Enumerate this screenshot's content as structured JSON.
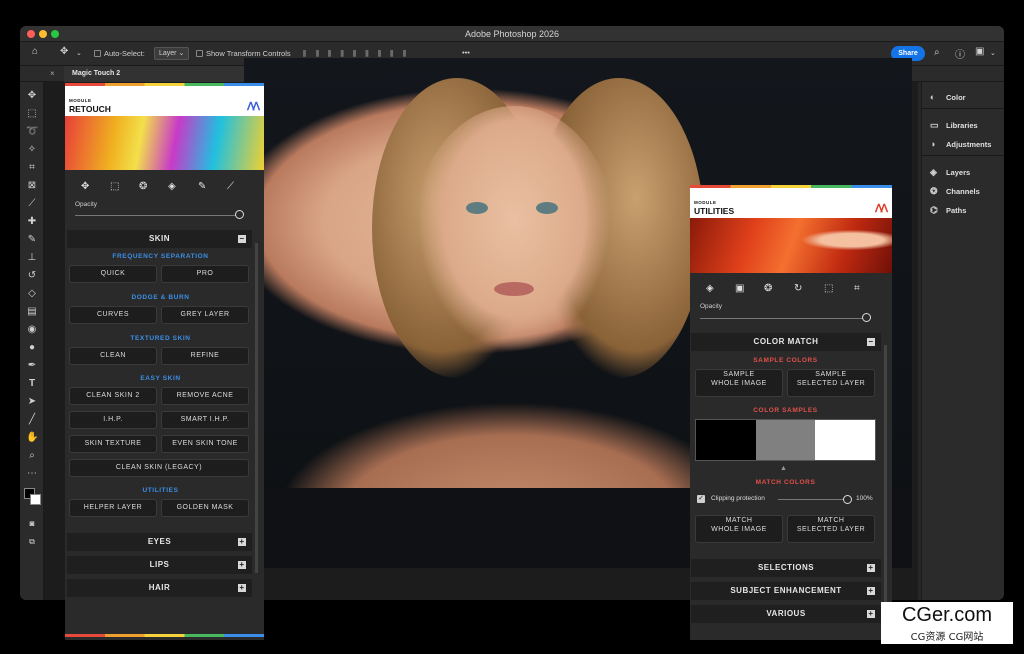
{
  "window": {
    "title": "Adobe Photoshop 2026"
  },
  "options_bar": {
    "auto_select_label": "Auto-Select:",
    "auto_select_value": "Layer",
    "show_transform_label": "Show Transform Controls",
    "more": "•••",
    "share_label": "Share"
  },
  "plugin_tab": {
    "label": "Magic Touch 2"
  },
  "right_panel": {
    "items": [
      "Color",
      "Libraries",
      "Adjustments",
      "Layers",
      "Channels",
      "Paths"
    ]
  },
  "retouch_panel": {
    "module_label": "MODULE",
    "module_title": "RETOUCH",
    "opacity_label": "Opacity",
    "opacity_value": 100,
    "section_skin": "SKIN",
    "sub_frequency": "FREQUENCY SEPARATION",
    "btn_quick": "QUICK",
    "btn_pro": "PRO",
    "sub_dodge": "DODGE & BURN",
    "btn_curves": "CURVES",
    "btn_grey_layer": "GREY LAYER",
    "sub_textured": "TEXTURED SKIN",
    "btn_clean": "CLEAN",
    "btn_refine": "REFINE",
    "sub_easy": "EASY SKIN",
    "btn_clean_skin_2": "CLEAN SKIN 2",
    "btn_remove_acne": "REMOVE ACNE",
    "btn_ihp": "I.H.P.",
    "btn_smart_ihp": "SMART I.H.P.",
    "btn_skin_texture": "SKIN TEXTURE",
    "btn_even_skin_tone": "EVEN SKIN TONE",
    "btn_clean_skin_legacy": "CLEAN SKIN (LEGACY)",
    "sub_utilities": "UTILITIES",
    "btn_helper_layer": "HELPER LAYER",
    "btn_golden_mask": "GOLDEN MASK",
    "section_eyes": "EYES",
    "section_lips": "LIPS",
    "section_hair": "HAIR"
  },
  "utilities_panel": {
    "module_label": "MODULE",
    "module_title": "UTILITIES",
    "opacity_label": "Opacity",
    "opacity_value": 100,
    "section_color_match": "COLOR MATCH",
    "sub_sample_colors": "SAMPLE COLORS",
    "btn_sample_whole_1": "SAMPLE",
    "btn_sample_whole_2": "WHOLE IMAGE",
    "btn_sample_selected_1": "SAMPLE",
    "btn_sample_selected_2": "SELECTED LAYER",
    "sub_color_samples": "COLOR SAMPLES",
    "swatches": [
      "#000000",
      "#808080",
      "#ffffff"
    ],
    "sub_match_colors": "MATCH COLORS",
    "clipping_label": "Clipping protection",
    "clipping_value": "100%",
    "btn_match_whole_1": "MATCH",
    "btn_match_whole_2": "WHOLE IMAGE",
    "btn_match_selected_1": "MATCH",
    "btn_match_selected_2": "SELECTED LAYER",
    "section_selections": "SELECTIONS",
    "section_subject": "SUBJECT ENHANCEMENT",
    "section_various": "VARIOUS"
  },
  "watermark": {
    "line1": "CGer.com",
    "line2": "CG资源 CG网站"
  },
  "colors": {
    "accent_blue": "#1473e6",
    "subheading_blue": "#3b8fe8",
    "subheading_red": "#e0504a"
  }
}
